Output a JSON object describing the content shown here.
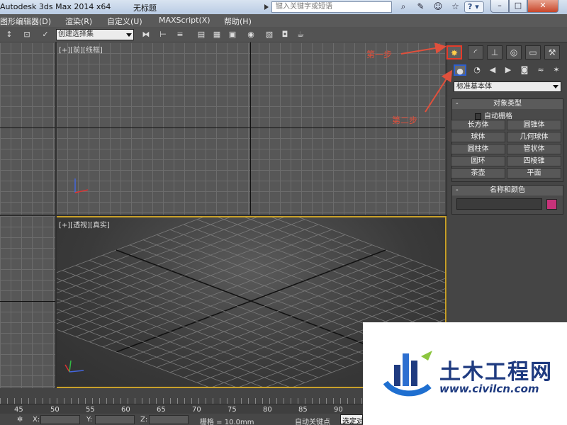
{
  "titlebar": {
    "app_title": "Autodesk 3ds Max  2014 x64",
    "doc_title": "无标题",
    "search_placeholder": "键入关键字或短语",
    "help_label": "?"
  },
  "menu": {
    "items": [
      "图形编辑器(D)",
      "渲染(R)",
      "自定义(U)",
      "MAXScript(X)",
      "帮助(H)"
    ]
  },
  "toolbar": {
    "selection_set": "创建选择集"
  },
  "viewports": {
    "front_label": "[+][前][线框]",
    "persp_label": "[+][透视][真实]"
  },
  "command_panel": {
    "category": "标准基本体",
    "object_type_title": "对象类型",
    "autogrid_label": "自动栅格",
    "buttons": [
      "长方体",
      "圆锥体",
      "球体",
      "几何球体",
      "圆柱体",
      "管状体",
      "圆环",
      "四棱锥",
      "茶壶",
      "平面"
    ],
    "name_color_title": "名称和颜色",
    "color": "#c8327a"
  },
  "annotations": {
    "step1": "第一步",
    "step2": "第二步"
  },
  "timeline": {
    "ticks": [
      "45",
      "50",
      "55",
      "60",
      "65",
      "70",
      "75",
      "80",
      "85",
      "90"
    ]
  },
  "status": {
    "x_label": "X:",
    "y_label": "Y:",
    "z_label": "Z:",
    "grid": "栅格 = 10.0mm",
    "auto_key": "自动关键点",
    "selected": "选定对"
  },
  "watermark": {
    "name": "土木工程网",
    "url": "www.civilcn.com"
  },
  "icons": {
    "create_tab": "create-icon",
    "geometry": "sphere-icon"
  }
}
